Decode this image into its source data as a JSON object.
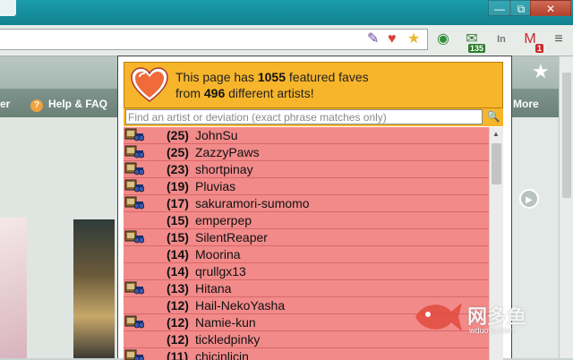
{
  "window": {
    "minimize_label": "—",
    "restore_label": "⧉",
    "close_label": "✕"
  },
  "toolbar": {
    "extensions": [
      {
        "name": "green-orb-extension",
        "badge": ""
      },
      {
        "name": "mail-checker-extension",
        "badge": "135"
      },
      {
        "name": "linkedin-extension",
        "badge": ""
      },
      {
        "name": "gmail-extension",
        "badge": "1"
      },
      {
        "name": "menu-extension",
        "badge": ""
      }
    ]
  },
  "site": {
    "nav_left": "er",
    "help_faq": "Help & FAQ",
    "more": "More"
  },
  "popup": {
    "header_line1_prefix": "This page has ",
    "header_count": "1055",
    "header_line1_suffix": " featured faves",
    "header_line2_prefix": "from ",
    "header_artists": "496",
    "header_line2_suffix": " different artists!",
    "search_placeholder": "Find an artist or deviation (exact phrase matches only)",
    "rows": [
      {
        "count": "(25)",
        "name": "JohnSu",
        "icon": true
      },
      {
        "count": "(25)",
        "name": "ZazzyPaws",
        "icon": true
      },
      {
        "count": "(23)",
        "name": "shortpinay",
        "icon": true
      },
      {
        "count": "(19)",
        "name": "Pluvias",
        "icon": true
      },
      {
        "count": "(17)",
        "name": "sakuramori-sumomo",
        "icon": true
      },
      {
        "count": "(15)",
        "name": "emperpep",
        "icon": false
      },
      {
        "count": "(15)",
        "name": "SilentReaper",
        "icon": true
      },
      {
        "count": "(14)",
        "name": "Moorina",
        "icon": false
      },
      {
        "count": "(14)",
        "name": "qrullgx13",
        "icon": false
      },
      {
        "count": "(13)",
        "name": "Hitana",
        "icon": true
      },
      {
        "count": "(12)",
        "name": "Hail-NekoYasha",
        "icon": false
      },
      {
        "count": "(12)",
        "name": "Namie-kun",
        "icon": true
      },
      {
        "count": "(12)",
        "name": "tickledpinky",
        "icon": false
      },
      {
        "count": "(11)",
        "name": "chicinlicin",
        "icon": true
      }
    ]
  },
  "watermark": {
    "text": "网多鱼",
    "sub": "wduoyu.com"
  },
  "colors": {
    "popup_header": "#f7b52b",
    "list_bg": "#f28a8a",
    "titlebar": "#1a9cac"
  }
}
